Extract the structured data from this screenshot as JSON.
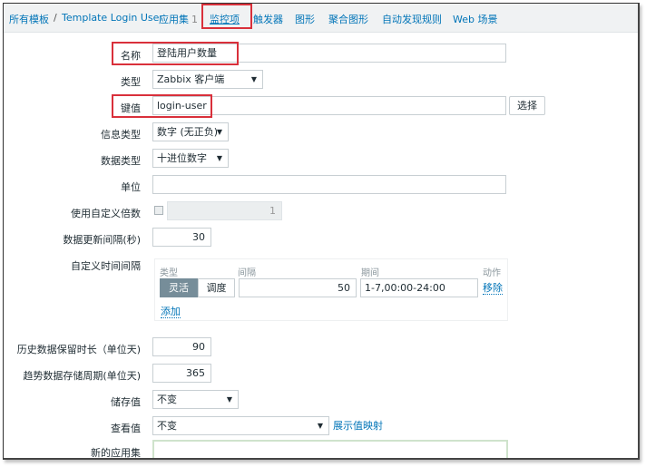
{
  "breadcrumb": {
    "all_templates": "所有模板",
    "separator": "/",
    "template_name": "Template Login User"
  },
  "tabs": [
    {
      "label": "应用集",
      "count": "1"
    },
    {
      "label": "监控项",
      "active": true
    },
    {
      "label": "触发器"
    },
    {
      "label": "图形"
    },
    {
      "label": "聚合图形"
    },
    {
      "label": "自动发现规则"
    },
    {
      "label": "Web 场景"
    }
  ],
  "form": {
    "name": {
      "label": "名称",
      "value": "登陆用户数量"
    },
    "type": {
      "label": "类型",
      "value": "Zabbix 客户端"
    },
    "key": {
      "label": "键值",
      "value": "login-user",
      "select_button": "选择"
    },
    "info_type": {
      "label": "信息类型",
      "value": "数字 (无正负)"
    },
    "data_type": {
      "label": "数据类型",
      "value": "十进位数字"
    },
    "units": {
      "label": "单位",
      "value": ""
    },
    "multiplier": {
      "label": "使用自定义倍数",
      "checked": false,
      "value": "1"
    },
    "update_interval": {
      "label": "数据更新间隔(秒)",
      "value": "30"
    },
    "custom_intervals": {
      "label": "自定义时间间隔",
      "headers": {
        "type": "类型",
        "interval": "间隔",
        "period": "期间",
        "action": "动作"
      },
      "rows": [
        {
          "type_options": [
            "灵活",
            "调度"
          ],
          "selected_type": "灵活",
          "interval": "50",
          "period": "1-7,00:00-24:00",
          "action": "移除"
        }
      ],
      "add_link": "添加"
    },
    "history": {
      "label": "历史数据保留时长（单位天)",
      "value": "90"
    },
    "trends": {
      "label": "趋势数据存储周期(单位天)",
      "value": "365"
    },
    "store_value": {
      "label": "储存值",
      "value": "不变"
    },
    "show_value": {
      "label": "查看值",
      "value": "不变",
      "mapping_link": "展示值映射"
    },
    "new_application": {
      "label": "新的应用集",
      "value": ""
    }
  },
  "colors": {
    "link": "#0275b8",
    "highlight": "#d9303b",
    "segment_active": "#768d99"
  }
}
